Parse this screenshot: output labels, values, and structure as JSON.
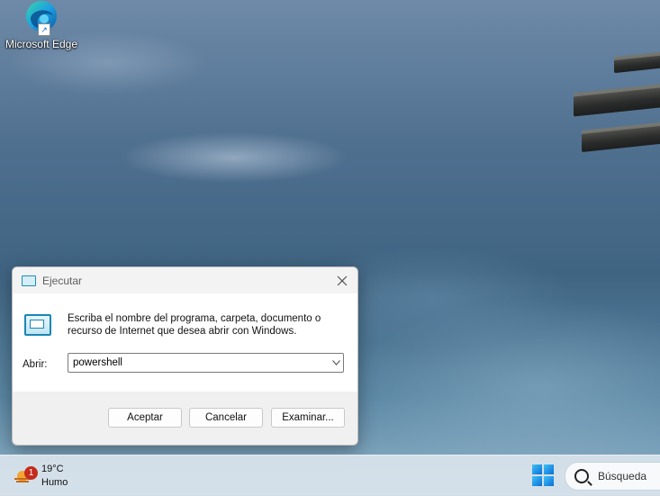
{
  "desktop": {
    "icons": [
      {
        "label": "Microsoft Edge",
        "icon": "edge-icon"
      }
    ]
  },
  "run_dialog": {
    "title": "Ejecutar",
    "description": "Escriba el nombre del programa, carpeta, documento o recurso de Internet que desea abrir con Windows.",
    "open_label": "Abrir:",
    "open_value": "powershell",
    "buttons": {
      "accept": "Aceptar",
      "cancel": "Cancelar",
      "browse": "Examinar..."
    }
  },
  "taskbar": {
    "weather": {
      "temperature": "19°C",
      "condition": "Humo",
      "badge_count": "1"
    },
    "search": {
      "placeholder": "Búsqueda"
    }
  },
  "colors": {
    "accent": "#0a6fd6",
    "badge": "#c42b1c"
  }
}
